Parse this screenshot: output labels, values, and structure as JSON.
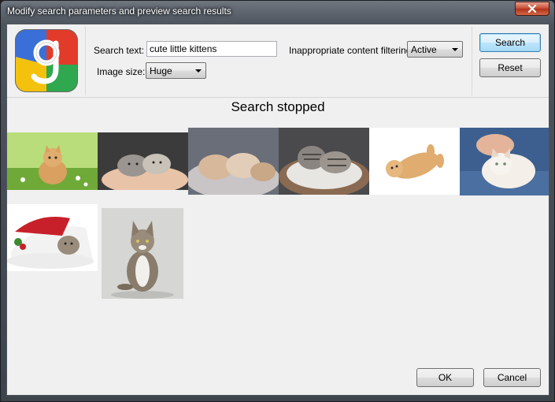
{
  "window": {
    "title": "Modify search parameters and preview search results"
  },
  "logo": {
    "icon": "google-logo-icon"
  },
  "form": {
    "search_text_label": "Search text:",
    "search_text_value": "cute little kittens",
    "image_size_label": "Image size:",
    "image_size_value": "Huge",
    "filter_label": "Inappropriate content filtering:",
    "filter_value": "Active"
  },
  "buttons": {
    "search": "Search",
    "reset": "Reset",
    "ok": "OK",
    "cancel": "Cancel"
  },
  "status": "Search stopped",
  "results": [
    {
      "icon": "kitten-in-grass-image"
    },
    {
      "icon": "two-kittens-in-hand-image"
    },
    {
      "icon": "sleeping-kittens-image"
    },
    {
      "icon": "tabby-kittens-in-basket-image"
    },
    {
      "icon": "kitten-lying-on-back-image"
    },
    {
      "icon": "kitten-on-jeans-image"
    },
    {
      "icon": "kitten-in-santa-hat-image"
    },
    {
      "icon": "maine-coon-kitten-image"
    }
  ],
  "colors": {
    "kitten_orange": "#d9a060",
    "kitten_grey": "#8a8580",
    "grass_green": "#8cc850",
    "jeans_blue": "#4a6fa0"
  }
}
